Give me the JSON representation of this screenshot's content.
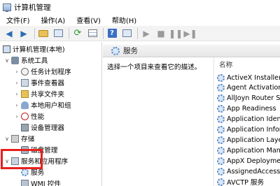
{
  "window": {
    "title": "计算机管理"
  },
  "menu": [
    "文件(F)",
    "操作(A)",
    "查看(V)",
    "帮助(H)"
  ],
  "tree": {
    "root": "计算机管理(本地)",
    "system_tools": "系统工具",
    "task_scheduler": "任务计划程序",
    "event_viewer": "事件查看器",
    "shared_folders": "共享文件夹",
    "local_users": "本地用户和组",
    "performance": "性能",
    "device_manager": "设备管理器",
    "storage": "存储",
    "disk_management": "磁盘管理",
    "services_apps": "服务和应用程序",
    "services": "服务",
    "wmi": "WMI 控件"
  },
  "services_panel": {
    "title": "服务",
    "description": "选择一个项目来查看它的描述。",
    "column_name": "名称",
    "items": [
      "ActiveX Installer (",
      "Agent Activation",
      "AllJoyn Router Se",
      "App Readiness",
      "Application Ident",
      "Application Infor",
      "Application Layer",
      "Application Mana",
      "AppX Deployment",
      "AssignedAccessM",
      "AVCTP 服务"
    ]
  },
  "colors": {
    "highlight": "#e8201e",
    "accent": "#2d6db5"
  }
}
